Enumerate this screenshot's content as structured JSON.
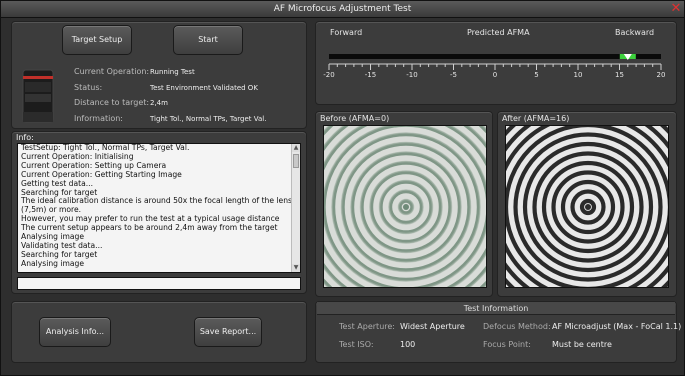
{
  "window": {
    "title": "AF Microfocus Adjustment Test"
  },
  "buttons": {
    "target_setup": "Target Setup",
    "start": "Start",
    "analysis_info": "Analysis Info...",
    "save_report": "Save Report..."
  },
  "status": {
    "current_operation_label": "Current Operation:",
    "current_operation_value": "Running Test",
    "status_label": "Status:",
    "status_value": "Test Environment Validated OK",
    "distance_label": "Distance to target:",
    "distance_value": "2,4m",
    "information_label": "Information:",
    "information_value": "Tight Tol., Normal TPs, Target Val."
  },
  "info": {
    "label": "Info:",
    "lines": [
      "TestSetup: Tight Tol., Normal TPs, Target Val.",
      "Current Operation: Initialising",
      "Current Operation: Setting up Camera",
      "Current Operation: Getting Starting Image",
      "Getting test data...",
      "Searching for target",
      "The ideal calibration distance is around 50x the focal length of the lens",
      "(7,5m) or more.",
      "However, you may prefer to run the test at a typical usage distance",
      "The current setup appears to be around 2,4m away from the target",
      "Analysing image",
      "Validating test data...",
      "Searching for target",
      "Analysing image"
    ]
  },
  "afma": {
    "forward_label": "Forward",
    "predicted_label": "Predicted AFMA",
    "backward_label": "Backward",
    "predicted_value": 16,
    "scale_min": -20,
    "scale_max": 20,
    "tick_labels": [
      "-20",
      "-15",
      "-10",
      "-5",
      "0",
      "5",
      "10",
      "15",
      "20"
    ],
    "indicator_color": "#3cd03c"
  },
  "images": {
    "before_title": "Before (AFMA=0)",
    "after_title": "After (AFMA=16)"
  },
  "test_information": {
    "title": "Test Information",
    "aperture_label": "Test Aperture:",
    "aperture_value": "Widest Aperture",
    "defocus_label": "Defocus Method:",
    "defocus_value": "AF Microadjust (Max - FoCal 1.1)",
    "iso_label": "Test ISO:",
    "iso_value": "100",
    "focus_point_label": "Focus Point:",
    "focus_point_value": "Must be centre"
  }
}
